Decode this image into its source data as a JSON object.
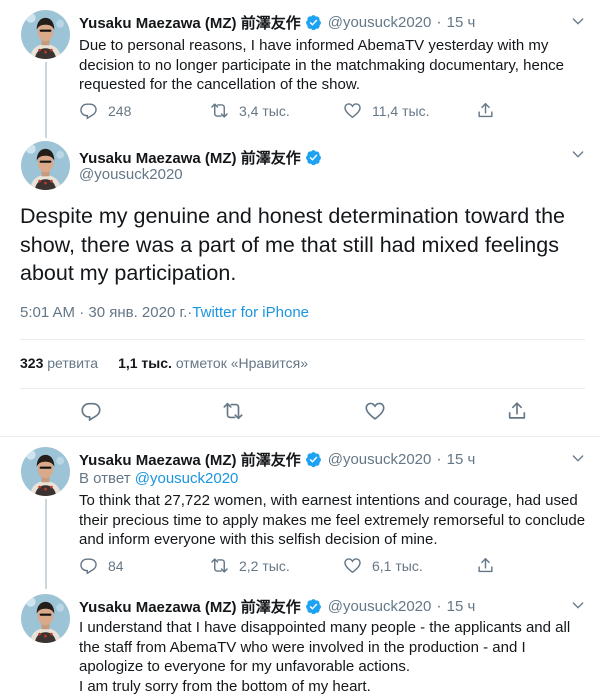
{
  "colors": {
    "accent": "#1da1f2",
    "muted": "#657786",
    "text": "#14171a",
    "border": "#e6ecf0"
  },
  "tweets": [
    {
      "name": "Yusaku Maezawa (MZ) 前澤友作",
      "handle": "@yousuck2020",
      "time": "15 ч",
      "text": "Due to personal reasons, I have informed AbemaTV yesterday with my decision to no longer participate in the matchmaking documentary, hence requested for the cancellation of the show.",
      "replies": "248",
      "retweets": "3,4 тыс.",
      "likes": "11,4 тыс."
    },
    {
      "name": "Yusaku Maezawa (MZ) 前澤友作",
      "handle": "@yousuck2020",
      "text": "Despite my genuine and honest determination toward the show, there was a part of me that still had mixed feelings about my participation.",
      "timestamp": "5:01 AM · 30 янв. 2020 г.",
      "source_sep": " · ",
      "source": "Twitter for iPhone",
      "retweet_count": "323",
      "retweet_label": "ретвита",
      "like_count": "1,1 тыс.",
      "like_label": "отметок «Нравится»"
    },
    {
      "name": "Yusaku Maezawa (MZ) 前澤友作",
      "handle": "@yousuck2020",
      "time": "15 ч",
      "reply_prefix": "В ответ",
      "reply_to": "@yousuck2020",
      "text": "To think that 27,722 women, with earnest intentions and courage, had used their precious time to apply makes me feel extremely remorseful to conclude and inform everyone with this selfish decision of mine.",
      "replies": "84",
      "retweets": "2,2 тыс.",
      "likes": "6,1 тыс."
    },
    {
      "name": "Yusaku Maezawa (MZ) 前澤友作",
      "handle": "@yousuck2020",
      "time": "15 ч",
      "text": "I understand that I have disappointed many people - the applicants and all the staff from AbemaTV who were involved in the production - and I apologize to everyone for my unfavorable actions.",
      "text2": "I am truly sorry from the bottom of my heart."
    }
  ]
}
